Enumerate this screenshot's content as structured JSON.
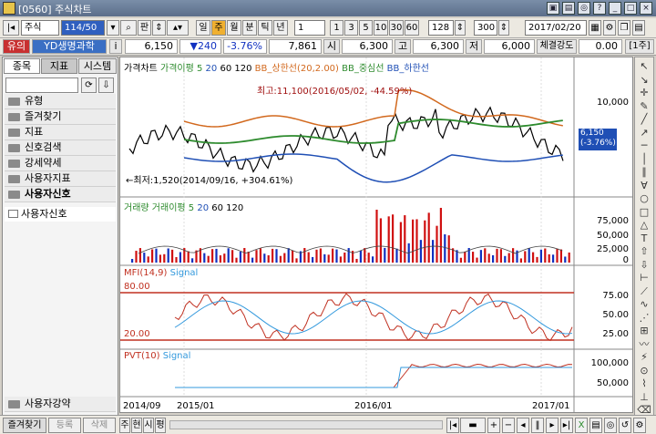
{
  "window": {
    "title": "[0560] 주식차트"
  },
  "toolbar": {
    "market": "주식",
    "code": "114/50",
    "btn_search": "판",
    "periods": [
      "일",
      "주",
      "월",
      "분",
      "틱",
      "년"
    ],
    "interval": "1",
    "nums": [
      "1",
      "3",
      "5",
      "10",
      "30",
      "60"
    ],
    "count": "128",
    "view_count": "300",
    "date": "2017/02/20"
  },
  "infobar": {
    "badge": "유의",
    "name": "YD생명과학",
    "info": "i",
    "price": "6,150",
    "change": "▼240",
    "rate": "-3.76%",
    "volume": "7,861",
    "open_label": "시",
    "open": "6,300",
    "high_label": "고",
    "high": "6,300",
    "low_label": "저",
    "low": "6,000",
    "strength_label": "체결강도",
    "strength": "0.00",
    "mode": "[1주]"
  },
  "left_panel": {
    "tabs": [
      "종목",
      "지표",
      "시스템"
    ],
    "items": [
      "유형",
      "즐겨찾기",
      "지표",
      "신호검색",
      "강세약세",
      "사용자지표",
      "사용자신호"
    ],
    "subitem": "사용자신호",
    "bottom_item": "사용자강약"
  },
  "price_pane": {
    "legend": [
      "가격차트",
      "가격이평 5",
      "20",
      "60",
      "120",
      "BB_상한선(20,2.00)",
      "BB_중심선",
      "BB_하한선"
    ],
    "high_note": "최고:11,100(2016/05/02, -44.59%)",
    "low_note": "←최저:1,520(2014/09/16, +304.61%)",
    "axis": [
      "10,000"
    ],
    "current": "6,150",
    "current_rate": "(-3.76%)"
  },
  "volume_pane": {
    "legend": [
      "거래량",
      "거래이평 5",
      "20",
      "60",
      "120"
    ],
    "axis": [
      "75,000",
      "50,000",
      "25,000",
      "0"
    ]
  },
  "mfi_pane": {
    "legend": [
      "MFI(14,9)",
      "Signal"
    ],
    "levels": [
      "80.00",
      "20.00"
    ],
    "axis": [
      "75.00",
      "50.00",
      "25.00"
    ]
  },
  "pvt_pane": {
    "legend": [
      "PVT(10)",
      "Signal"
    ],
    "axis": [
      "100,000",
      "50,000"
    ]
  },
  "x_axis": [
    "2014/09",
    "2015/01",
    "2016/01",
    "2017/01"
  ],
  "bottom": {
    "tabs": [
      "즐겨찾기",
      "등록",
      "삭제"
    ],
    "modes": [
      "주",
      "현",
      "시",
      "평"
    ]
  },
  "colors": {
    "price": "#000000",
    "ma5": "#2e8b2e",
    "bb_upper": "#d2691e",
    "bb_lower": "#1f4fb5",
    "vol_up": "#d01010",
    "vol_down": "#1030c0",
    "mfi": "#c03020",
    "signal": "#3399dd"
  }
}
